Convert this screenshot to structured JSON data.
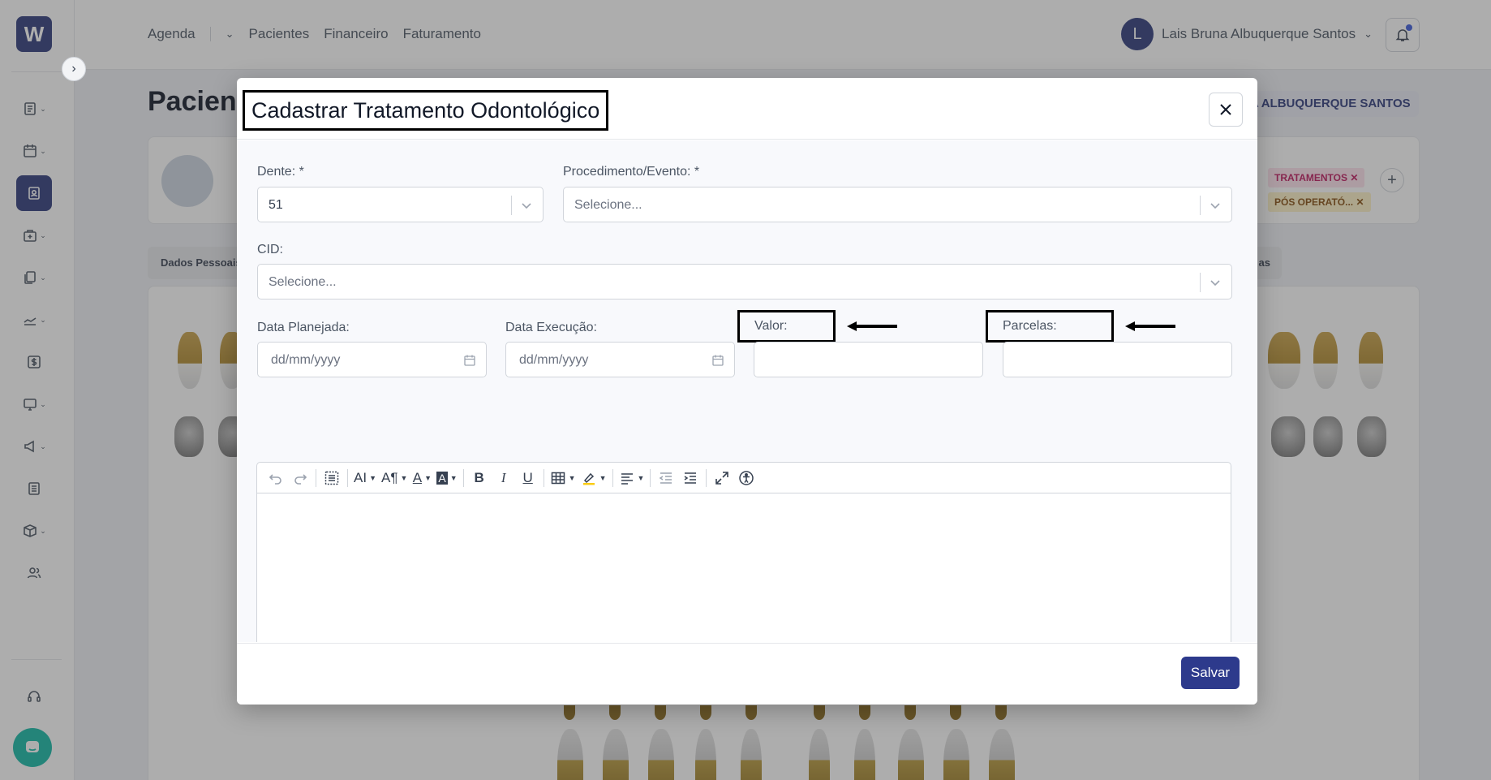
{
  "app": {
    "logo_text": "W",
    "topnav": [
      "Agenda",
      "Pacientes",
      "Financeiro",
      "Faturamento"
    ],
    "user_initial": "L",
    "user_name": "Lais Bruna Albuquerque Santos",
    "page_title": "Pacient",
    "patient_button": "NA ALBUQUERQUE SANTOS",
    "tags": [
      "TRATAMENTOS",
      "PÓS OPERATÓ..."
    ],
    "tab_first": "Dados Pessoais",
    "tab_last": "as",
    "colors": {
      "primary": "#2d3a7a",
      "chat": "#14b8a6"
    }
  },
  "modal": {
    "title": "Cadastrar Tratamento Odontológico",
    "fields": {
      "dente_label": "Dente: *",
      "dente_value": "51",
      "procedimento_label": "Procedimento/Evento: *",
      "procedimento_placeholder": "Selecione...",
      "cid_label": "CID:",
      "cid_placeholder": "Selecione...",
      "data_planejada_label": "Data Planejada:",
      "data_planejada_placeholder": "dd/mm/yyyy",
      "data_execucao_label": "Data Execução:",
      "data_execucao_placeholder": "dd/mm/yyyy",
      "valor_label": "Valor:",
      "parcelas_label": "Parcelas:"
    },
    "save_label": "Salvar"
  }
}
